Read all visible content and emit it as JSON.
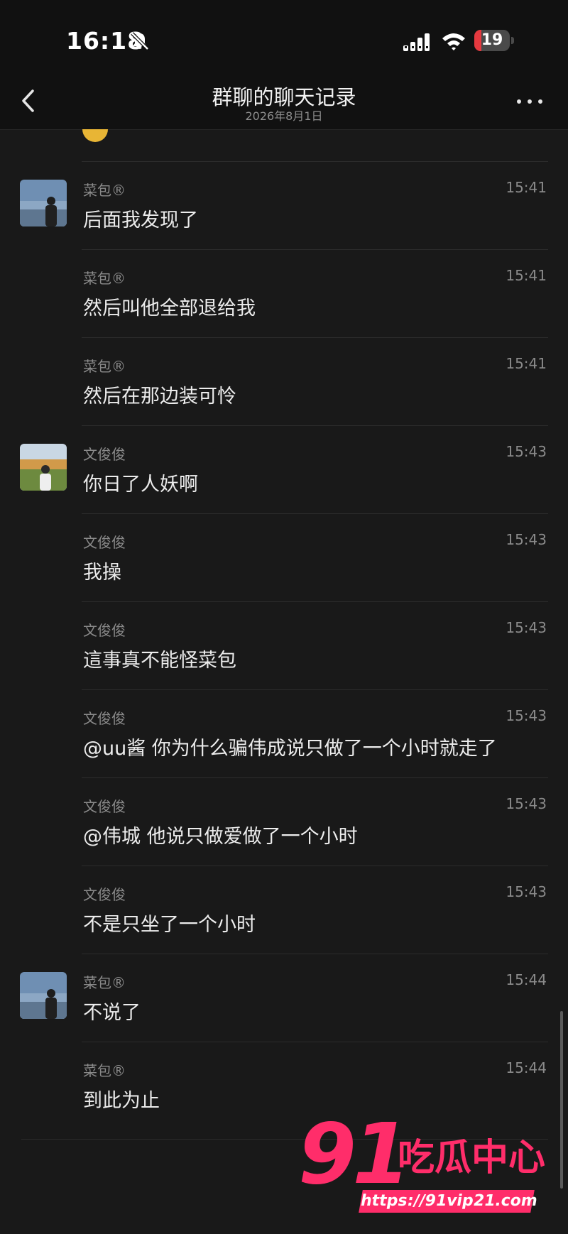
{
  "status_bar": {
    "time": "16:18",
    "battery_level": "19",
    "battery_fraction": 0.19,
    "icons": [
      "bell-muted-icon",
      "cellular-signal-icon",
      "wifi-icon",
      "battery-icon"
    ]
  },
  "nav": {
    "title": "群聊的聊天记录",
    "subtitle": "2026年8月1日",
    "back_icon": "chevron-left-icon",
    "more_icon": "more-dots-icon"
  },
  "messages": [
    {
      "sender": "菜包®",
      "time": "15:41",
      "text": "后面我发现了",
      "avatar": "avatar-caibao"
    },
    {
      "sender": "菜包®",
      "time": "15:41",
      "text": "然后叫他全部退给我"
    },
    {
      "sender": "菜包®",
      "time": "15:41",
      "text": "然后在那边装可怜"
    },
    {
      "sender": "文俊俊",
      "time": "15:43",
      "text": "你日了人妖啊",
      "avatar": "avatar-wenjunjun"
    },
    {
      "sender": "文俊俊",
      "time": "15:43",
      "text": "我操"
    },
    {
      "sender": "文俊俊",
      "time": "15:43",
      "text": "這事真不能怪菜包"
    },
    {
      "sender": "文俊俊",
      "time": "15:43",
      "text": "@uu酱 你为什么骗伟成说只做了一个小时就走了"
    },
    {
      "sender": "文俊俊",
      "time": "15:43",
      "text": "@伟城 他说只做爱做了一个小时"
    },
    {
      "sender": "文俊俊",
      "time": "15:43",
      "text": "不是只坐了一个小时"
    },
    {
      "sender": "菜包®",
      "time": "15:44",
      "text": "不说了",
      "avatar": "avatar-caibao"
    },
    {
      "sender": "菜包®",
      "time": "15:44",
      "text": "到此为止"
    }
  ],
  "watermark": {
    "number": "91",
    "name": "吃瓜中心",
    "url": "https://91vip21.com",
    "color": "#ff2d6a"
  }
}
